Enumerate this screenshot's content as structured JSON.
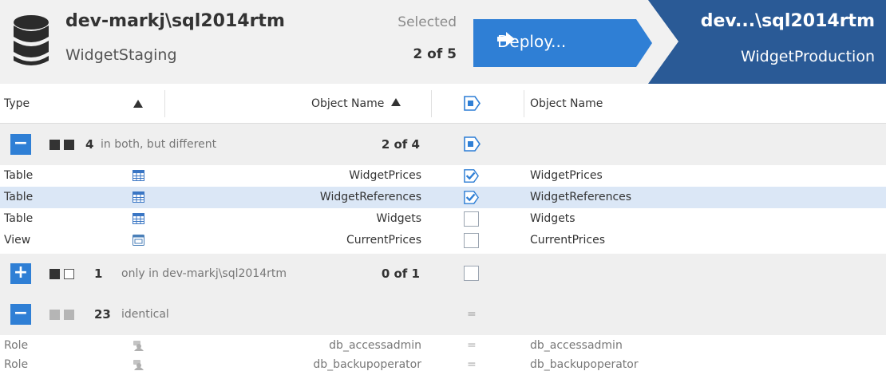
{
  "source": {
    "server": "dev-markj\\sql2014rtm",
    "database": "WidgetStaging",
    "icon": "database-icon"
  },
  "selection": {
    "label": "Selected",
    "count": "2 of 5"
  },
  "deploy": {
    "label": "Deploy...",
    "icon": "arrow-right-icon",
    "color": "#2f7fd5"
  },
  "target": {
    "server": "dev...\\sql2014rtm",
    "database": "WidgetProduction",
    "color": "#2a5a96"
  },
  "columns": {
    "type": "Type",
    "object_name": "Object Name",
    "target_object_name": "Object Name"
  },
  "groups": {
    "different": {
      "toggle": "−",
      "count": "4",
      "label": "in both, but different",
      "selected": "2 of 4",
      "rows": [
        {
          "type": "Table",
          "name": "WidgetPrices",
          "target": "WidgetPrices",
          "checked": true,
          "icon": "table-icon"
        },
        {
          "type": "Table",
          "name": "WidgetReferences",
          "target": "WidgetReferences",
          "checked": true,
          "icon": "table-icon"
        },
        {
          "type": "Table",
          "name": "Widgets",
          "target": "Widgets",
          "checked": false,
          "icon": "table-icon"
        },
        {
          "type": "View",
          "name": "CurrentPrices",
          "target": "CurrentPrices",
          "checked": false,
          "icon": "view-icon"
        }
      ]
    },
    "only_source": {
      "toggle": "+",
      "count": "1",
      "label": "only in dev-markj\\sql2014rtm",
      "selected": "0 of 1"
    },
    "identical": {
      "toggle": "−",
      "count": "23",
      "label": "identical",
      "selected": "=",
      "rows": [
        {
          "type": "Role",
          "name": "db_accessadmin",
          "target": "db_accessadmin",
          "eq": "=",
          "icon": "role-icon"
        },
        {
          "type": "Role",
          "name": "db_backupoperator",
          "target": "db_backupoperator",
          "eq": "=",
          "icon": "role-icon"
        }
      ]
    }
  }
}
